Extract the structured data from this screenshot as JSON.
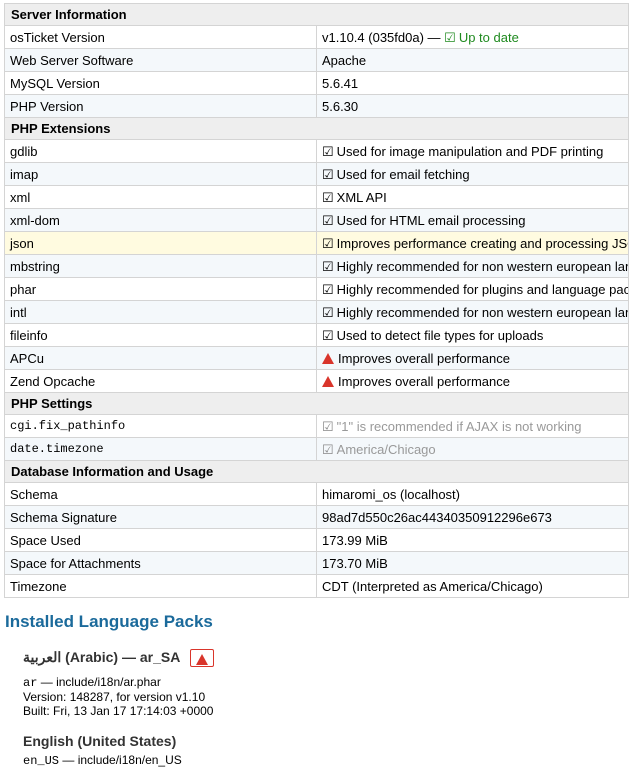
{
  "server": {
    "header": "Server Information",
    "rows": [
      {
        "k": "osTicket Version",
        "v": "v1.10.4 (035fd0a) —",
        "status": "Up to date"
      },
      {
        "k": "Web Server Software",
        "v": "Apache"
      },
      {
        "k": "MySQL Version",
        "v": "5.6.41"
      },
      {
        "k": "PHP Version",
        "v": "5.6.30"
      }
    ]
  },
  "extensions": {
    "header": "PHP Extensions",
    "rows": [
      {
        "k": "gdlib",
        "v": "Used for image manipulation and PDF printing",
        "icon": "check"
      },
      {
        "k": "imap",
        "v": "Used for email fetching",
        "icon": "check"
      },
      {
        "k": "xml",
        "v": "XML API",
        "icon": "check"
      },
      {
        "k": "xml-dom",
        "v": "Used for HTML email processing",
        "icon": "check"
      },
      {
        "k": "json",
        "v": "Improves performance creating and processing JSON",
        "icon": "check"
      },
      {
        "k": "mbstring",
        "v": "Highly recommended for non western european language content",
        "icon": "check"
      },
      {
        "k": "phar",
        "v": "Highly recommended for plugins and language packs",
        "icon": "check"
      },
      {
        "k": "intl",
        "v": "Highly recommended for non western european language content",
        "icon": "check"
      },
      {
        "k": "fileinfo",
        "v": "Used to detect file types for uploads",
        "icon": "check"
      },
      {
        "k": "APCu",
        "v": "Improves overall performance",
        "icon": "warning"
      },
      {
        "k": "Zend Opcache",
        "v": "Improves overall performance",
        "icon": "warning"
      }
    ]
  },
  "settings": {
    "header": "PHP Settings",
    "rows": [
      {
        "k": "cgi.fix_pathinfo",
        "v": "\"1\" is recommended if AJAX is not working"
      },
      {
        "k": "date.timezone",
        "v": "America/Chicago"
      }
    ]
  },
  "database": {
    "header": "Database Information and Usage",
    "rows": [
      {
        "k": "Schema",
        "v": "himaromi_os (localhost)"
      },
      {
        "k": "Schema Signature",
        "v": "98ad7d550c26ac44340350912296e673"
      },
      {
        "k": "Space Used",
        "v": "173.99 MiB"
      },
      {
        "k": "Space for Attachments",
        "v": "173.70 MiB"
      },
      {
        "k": "Timezone",
        "v": "CDT (Interpreted as America/Chicago)"
      }
    ]
  },
  "language_packs": {
    "title": "Installed Language Packs",
    "packs": [
      {
        "name": "العربية (Arabic) — ar_SA",
        "code": "ar",
        "path": "— include/i18n/ar.phar",
        "version": "Version: 148287, for version v1.10",
        "built": "Built: Fri, 13 Jan 17 17:14:03 +0000"
      },
      {
        "name": "English (United States)",
        "code": "en_US",
        "path": "— include/i18n/en_US"
      }
    ]
  },
  "colors": {
    "ok": "#1f8a1f",
    "warning": "#d9352b",
    "heading": "#1b6a9b",
    "highlight": "#fffbe0"
  }
}
